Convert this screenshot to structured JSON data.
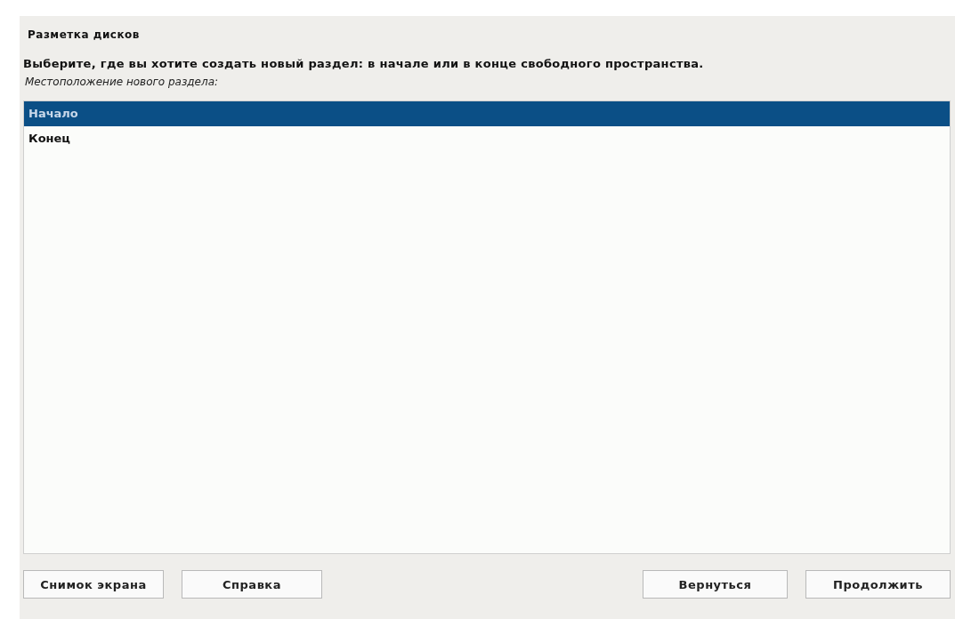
{
  "title": "Разметка дисков",
  "question": "Выберите, где вы хотите создать новый раздел: в начале или в конце свободного пространства.",
  "prompt": "Местоположение нового раздела:",
  "options": [
    {
      "label": "Начало",
      "selected": true
    },
    {
      "label": "Конец",
      "selected": false
    }
  ],
  "buttons_left": [
    "Снимок экрана",
    "Справка"
  ],
  "buttons_right": [
    "Вернуться",
    "Продолжить"
  ]
}
